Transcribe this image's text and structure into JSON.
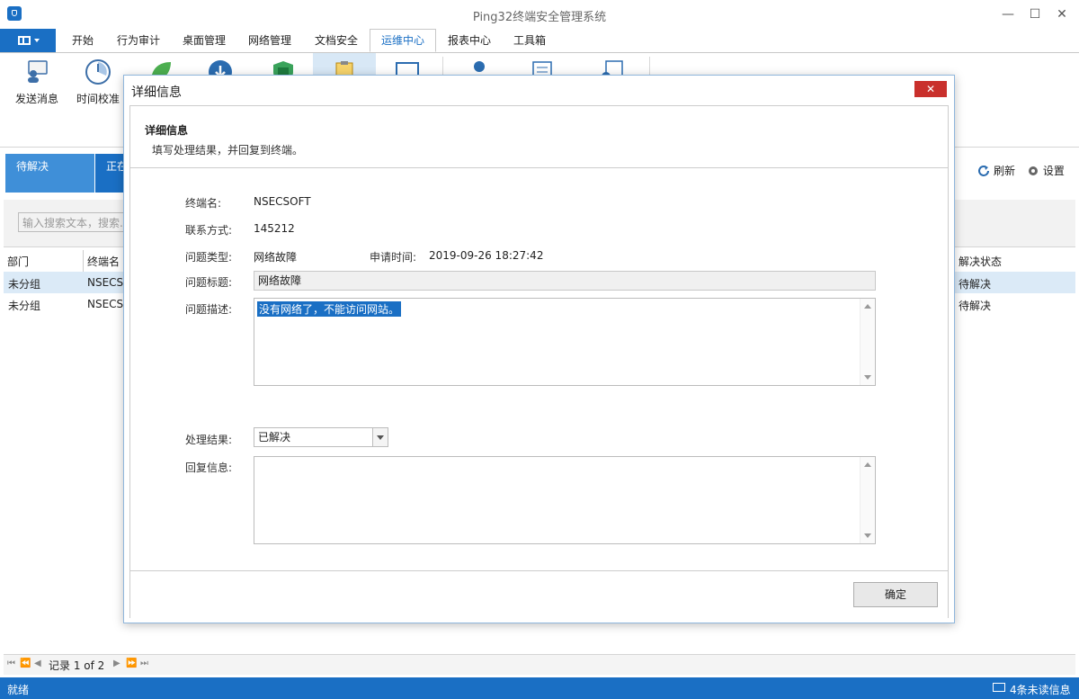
{
  "window": {
    "title": "Ping32终端安全管理系统",
    "minimize": "—",
    "maximize": "☐",
    "close": "✕"
  },
  "menu": {
    "tabs": [
      "开始",
      "行为审计",
      "桌面管理",
      "网络管理",
      "文档安全",
      "运维中心",
      "报表中心",
      "工具箱"
    ],
    "active": "运维中心"
  },
  "ribbon": {
    "items": [
      {
        "label": "发送消息",
        "icon": "send-message-icon"
      },
      {
        "label": "时间校准",
        "icon": "clock-icon"
      }
    ]
  },
  "status_tabs": {
    "pending": "待解决",
    "in_progress_partial": "正在"
  },
  "toolbar_right": {
    "refresh": "刷新",
    "settings": "设置"
  },
  "search": {
    "placeholder": "输入搜索文本，搜索..."
  },
  "grid": {
    "headers": {
      "dept": "部门",
      "terminal": "终端名",
      "status": "解决状态"
    },
    "rows": [
      {
        "dept": "未分组",
        "terminal": "NSECS",
        "status": "待解决"
      },
      {
        "dept": "未分组",
        "terminal": "NSECS",
        "status": "待解决"
      }
    ]
  },
  "pager": {
    "text": "记录 1 of 2"
  },
  "statusbar": {
    "left": "就绪",
    "right": "4条未读信息"
  },
  "dialog": {
    "title": "详细信息",
    "close": "✕",
    "header_title": "详细信息",
    "header_sub": "填写处理结果，并回复到终端。",
    "fields": {
      "terminal_label": "终端名:",
      "terminal_value": "NSECSOFT",
      "contact_label": "联系方式:",
      "contact_value": "145212",
      "type_label": "问题类型:",
      "type_value": "网络故障",
      "apply_time_label": "申请时间:",
      "apply_time_value": "2019-09-26 18:27:42",
      "subject_label": "问题标题:",
      "subject_value": "网络故障",
      "desc_label": "问题描述:",
      "desc_value": "没有网络了，不能访问网站。",
      "result_label": "处理结果:",
      "result_value": "已解决",
      "reply_label": "回复信息:",
      "reply_value": ""
    },
    "confirm": "确定"
  },
  "colors": {
    "accent": "#1a6fc4",
    "close_red": "#c9302c",
    "selected_row": "#dbeaf7"
  }
}
